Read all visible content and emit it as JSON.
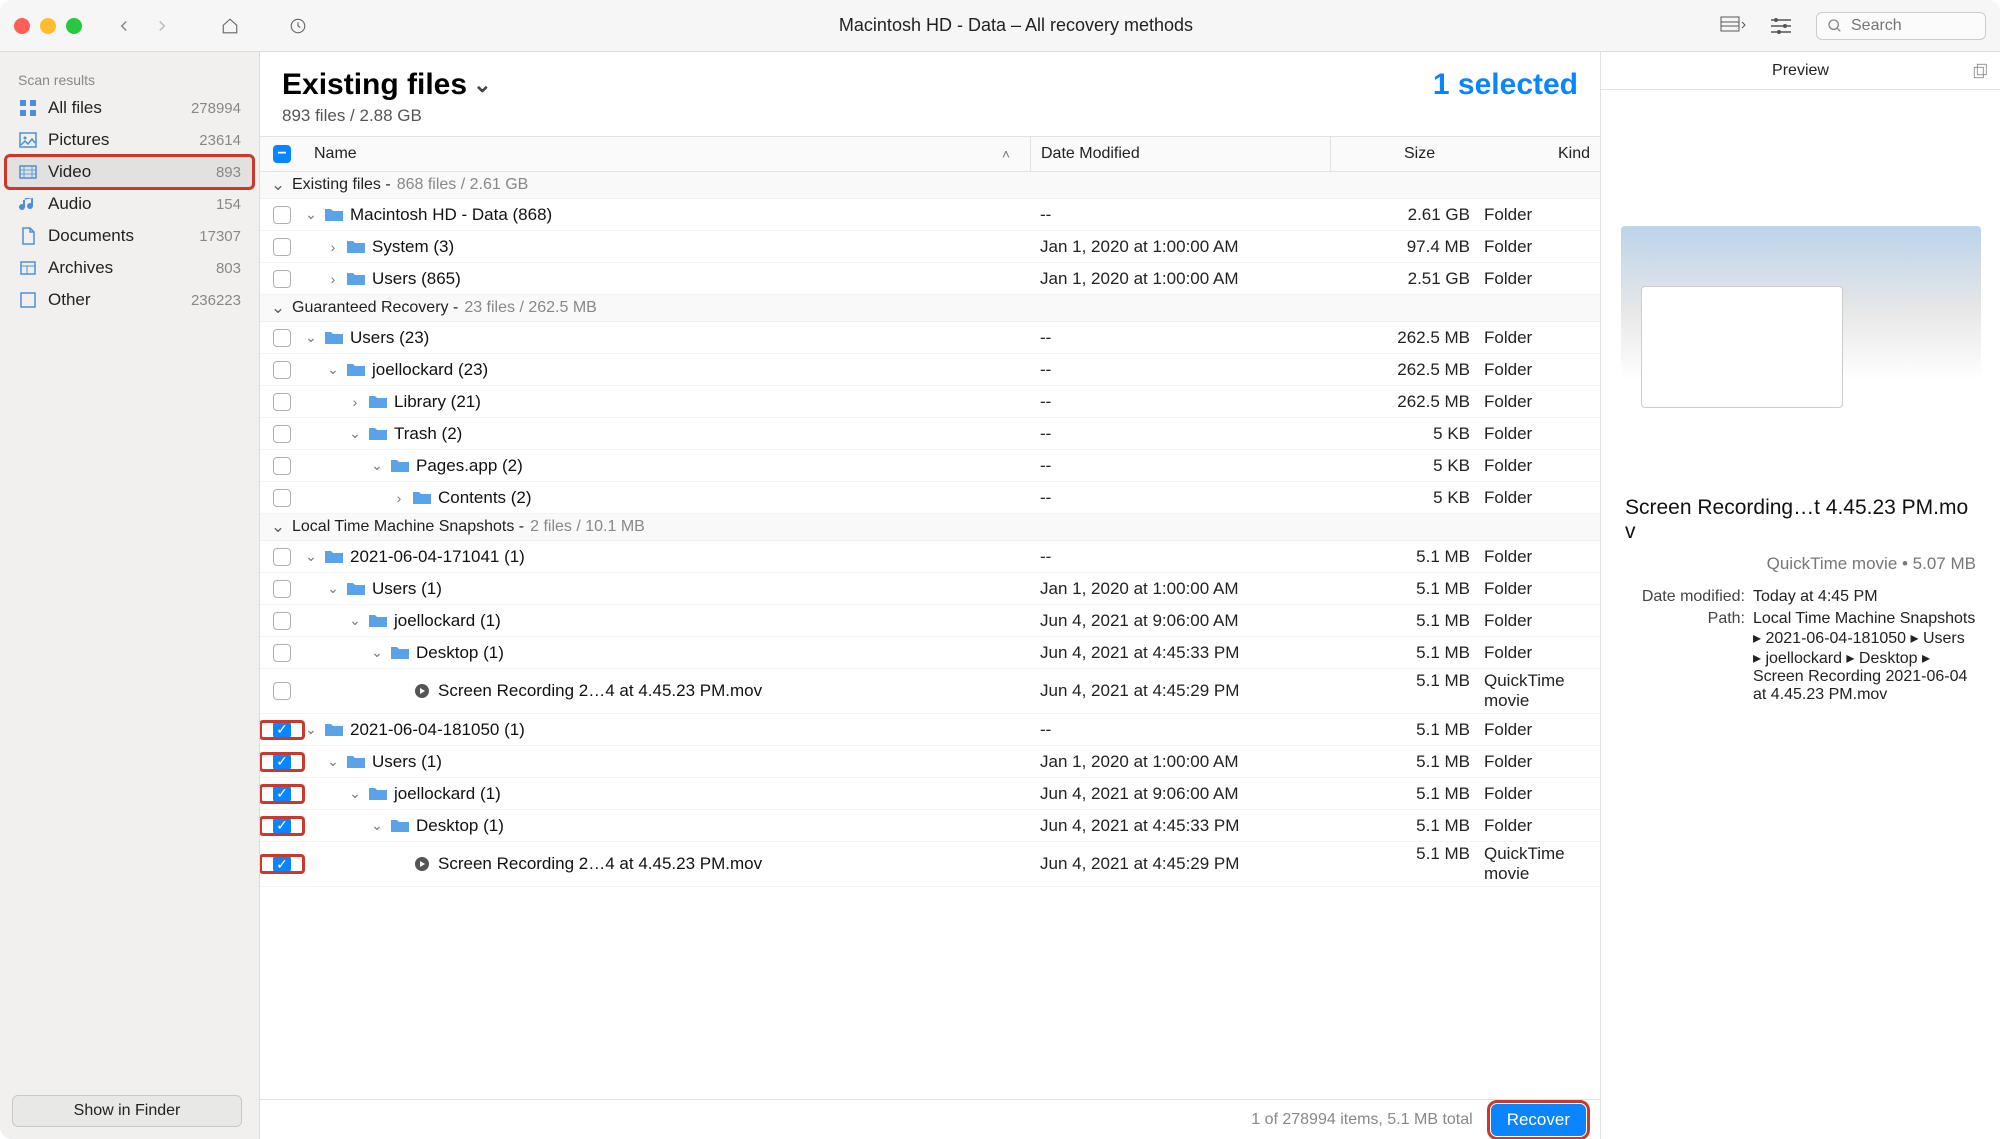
{
  "window_title": "Macintosh HD - Data – All recovery methods",
  "search_placeholder": "Search",
  "sidebar": {
    "label": "Scan results",
    "items": [
      {
        "label": "All files",
        "count": "278994",
        "icon": "grid"
      },
      {
        "label": "Pictures",
        "count": "23614",
        "icon": "picture"
      },
      {
        "label": "Video",
        "count": "893",
        "icon": "video",
        "active": true,
        "highlight": true
      },
      {
        "label": "Audio",
        "count": "154",
        "icon": "audio"
      },
      {
        "label": "Documents",
        "count": "17307",
        "icon": "document"
      },
      {
        "label": "Archives",
        "count": "803",
        "icon": "archive"
      },
      {
        "label": "Other",
        "count": "236223",
        "icon": "other"
      }
    ],
    "footer_btn": "Show in Finder"
  },
  "main": {
    "title": "Existing files",
    "subhead": "893 files / 2.88 GB",
    "selected": "1 selected",
    "columns": {
      "name": "Name",
      "date": "Date Modified",
      "size": "Size",
      "kind": "Kind"
    }
  },
  "sections": [
    {
      "title": "Existing files",
      "meta": "868 files / 2.61 GB"
    },
    {
      "title": "Guaranteed Recovery",
      "meta": "23 files / 262.5 MB"
    },
    {
      "title": "Local Time Machine Snapshots",
      "meta": "2 files / 10.1 MB"
    }
  ],
  "rows": [
    {
      "sec": 0,
      "indent": 0,
      "disc": "down",
      "chk": "off",
      "icon": "folder",
      "name": "Macintosh HD - Data (868)",
      "date": "--",
      "size": "2.61 GB",
      "kind": "Folder"
    },
    {
      "sec": 0,
      "indent": 1,
      "disc": "right",
      "chk": "off",
      "icon": "folder",
      "name": "System (3)",
      "date": "Jan 1, 2020 at 1:00:00 AM",
      "size": "97.4 MB",
      "kind": "Folder"
    },
    {
      "sec": 0,
      "indent": 1,
      "disc": "right",
      "chk": "off",
      "icon": "folder",
      "name": "Users (865)",
      "date": "Jan 1, 2020 at 1:00:00 AM",
      "size": "2.51 GB",
      "kind": "Folder"
    },
    {
      "sec": 1,
      "indent": 0,
      "disc": "down",
      "chk": "off",
      "icon": "folder",
      "name": "Users (23)",
      "date": "--",
      "size": "262.5 MB",
      "kind": "Folder"
    },
    {
      "sec": 1,
      "indent": 1,
      "disc": "down",
      "chk": "off",
      "icon": "folder",
      "name": "joellockard (23)",
      "date": "--",
      "size": "262.5 MB",
      "kind": "Folder"
    },
    {
      "sec": 1,
      "indent": 2,
      "disc": "right",
      "chk": "off",
      "icon": "folder",
      "name": "Library (21)",
      "date": "--",
      "size": "262.5 MB",
      "kind": "Folder"
    },
    {
      "sec": 1,
      "indent": 2,
      "disc": "down",
      "chk": "off",
      "icon": "folder",
      "name": "Trash (2)",
      "date": "--",
      "size": "5 KB",
      "kind": "Folder"
    },
    {
      "sec": 1,
      "indent": 3,
      "disc": "down",
      "chk": "off",
      "icon": "folder",
      "name": "Pages.app (2)",
      "date": "--",
      "size": "5 KB",
      "kind": "Folder"
    },
    {
      "sec": 1,
      "indent": 4,
      "disc": "right",
      "chk": "off",
      "icon": "folder",
      "name": "Contents (2)",
      "date": "--",
      "size": "5 KB",
      "kind": "Folder"
    },
    {
      "sec": 2,
      "indent": 0,
      "disc": "down",
      "chk": "off",
      "icon": "folder",
      "name": "2021-06-04-171041 (1)",
      "date": "--",
      "size": "5.1 MB",
      "kind": "Folder"
    },
    {
      "sec": 2,
      "indent": 1,
      "disc": "down",
      "chk": "off",
      "icon": "folder",
      "name": "Users (1)",
      "date": "Jan 1, 2020 at 1:00:00 AM",
      "size": "5.1 MB",
      "kind": "Folder"
    },
    {
      "sec": 2,
      "indent": 2,
      "disc": "down",
      "chk": "off",
      "icon": "folder",
      "name": "joellockard (1)",
      "date": "Jun 4, 2021 at 9:06:00 AM",
      "size": "5.1 MB",
      "kind": "Folder"
    },
    {
      "sec": 2,
      "indent": 3,
      "disc": "down",
      "chk": "off",
      "icon": "folder",
      "name": "Desktop (1)",
      "date": "Jun 4, 2021 at 4:45:33 PM",
      "size": "5.1 MB",
      "kind": "Folder"
    },
    {
      "sec": 2,
      "indent": 4,
      "disc": "",
      "chk": "off",
      "icon": "mov",
      "name": "Screen Recording 2…4 at 4.45.23 PM.mov",
      "date": "Jun 4, 2021 at 4:45:29 PM",
      "size": "5.1 MB",
      "kind": "QuickTime movie"
    },
    {
      "sec": 2,
      "indent": 0,
      "disc": "down",
      "chk": "on",
      "icon": "folder",
      "name": "2021-06-04-181050 (1)",
      "date": "--",
      "size": "5.1 MB",
      "kind": "Folder",
      "hl": true
    },
    {
      "sec": 2,
      "indent": 1,
      "disc": "down",
      "chk": "on",
      "icon": "folder",
      "name": "Users (1)",
      "date": "Jan 1, 2020 at 1:00:00 AM",
      "size": "5.1 MB",
      "kind": "Folder",
      "hl": true
    },
    {
      "sec": 2,
      "indent": 2,
      "disc": "down",
      "chk": "on",
      "icon": "folder",
      "name": "joellockard (1)",
      "date": "Jun 4, 2021 at 9:06:00 AM",
      "size": "5.1 MB",
      "kind": "Folder",
      "hl": true
    },
    {
      "sec": 2,
      "indent": 3,
      "disc": "down",
      "chk": "on",
      "icon": "folder",
      "name": "Desktop (1)",
      "date": "Jun 4, 2021 at 4:45:33 PM",
      "size": "5.1 MB",
      "kind": "Folder",
      "hl": true
    },
    {
      "sec": 2,
      "indent": 4,
      "disc": "",
      "chk": "on",
      "icon": "mov",
      "name": "Screen Recording 2…4 at 4.45.23 PM.mov",
      "date": "Jun 4, 2021 at 4:45:29 PM",
      "size": "5.1 MB",
      "kind": "QuickTime movie",
      "hl": true
    }
  ],
  "preview": {
    "label": "Preview",
    "filename": "Screen Recording…t 4.45.23 PM.mov",
    "subline": "QuickTime movie • 5.07 MB",
    "meta": {
      "date_mod_label": "Date modified:",
      "date_mod": "Today at 4:45 PM",
      "path_label": "Path:",
      "path": "Local Time Machine Snapshots ▸ 2021-06-04-181050 ▸ Users ▸ joellockard ▸ Desktop ▸ Screen Recording 2021-06-04 at 4.45.23 PM.mov"
    }
  },
  "footer": {
    "status": "1 of 278994 items, 5.1 MB total",
    "recover": "Recover"
  }
}
